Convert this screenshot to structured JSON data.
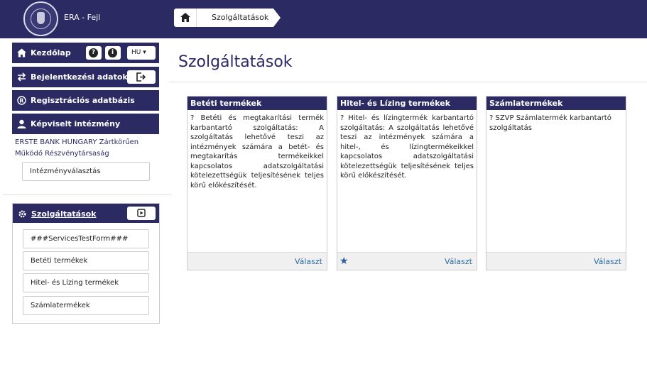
{
  "header": {
    "app_title": "ERA - Fejl",
    "breadcrumb": "Szolgáltatások"
  },
  "sidebar": {
    "home_label": "Kezdőlap",
    "lang": "HU",
    "login_data_label": "Bejelentkezési adatok",
    "registry_label": "Regisztrációs adatbázis",
    "represented_label": "Képviselt intézmény",
    "institution_name": "ERSTE BANK HUNGARY Zártkörűen Működő Részvénytársaság",
    "institution_select_label": "Intézményválasztás",
    "services_label": "Szolgáltatások",
    "services_items": [
      "###ServicesTestForm###",
      "Betéti termékek",
      "Hitel- és Lízing termékek",
      "Számlatermékek"
    ]
  },
  "main": {
    "title": "Szolgáltatások",
    "cards": [
      {
        "title": "Betéti termékek",
        "body": "? Betéti és megtakarítási termék karbantartó szolgáltatás: A szolgáltatás lehetővé teszi az intézmények számára a betét- és megtakarítás termékeikkel kapcsolatos adatszolgáltatási kötelezettségük teljesítésének teljes körű előkészítését.",
        "choose": "Választ"
      },
      {
        "title": "Hitel- és Lízing termékek",
        "body": "? Hitel- és lízingtermék karbantartó szolgáltatás: A szolgáltatás lehetővé teszi az intézmények számára a hitel-, és lízingtermékeikkel kapcsolatos adatszolgáltatási kötelezettségük teljesítésének teljes körű előkészítését.",
        "choose": "Választ",
        "starred": true
      },
      {
        "title": "Számlatermékek",
        "body": "? SZVP Számlatermék karbantartó szolgáltatás",
        "choose": "Választ"
      }
    ]
  }
}
